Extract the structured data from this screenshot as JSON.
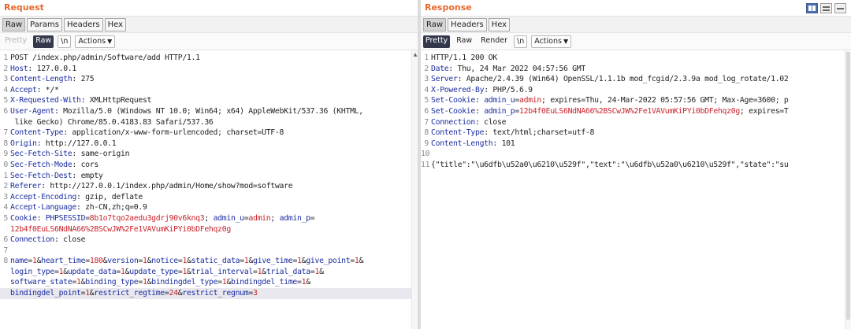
{
  "request": {
    "title": "Request",
    "tabs": [
      "Raw",
      "Params",
      "Headers",
      "Hex"
    ],
    "toolbar": {
      "pretty": "Pretty",
      "raw": "Raw",
      "newline": "\\n",
      "actions": "Actions"
    },
    "lines": [
      {
        "n": "1",
        "parts": [
          [
            "t",
            "POST /index.php/admin/Software/add HTTP/1.1"
          ]
        ]
      },
      {
        "n": "2",
        "parts": [
          [
            "k",
            "Host"
          ],
          [
            "t",
            ": 127.0.0.1"
          ]
        ]
      },
      {
        "n": "3",
        "parts": [
          [
            "k",
            "Content-Length"
          ],
          [
            "t",
            ": 275"
          ]
        ]
      },
      {
        "n": "4",
        "parts": [
          [
            "k",
            "Accept"
          ],
          [
            "t",
            ": */*"
          ]
        ]
      },
      {
        "n": "5",
        "parts": [
          [
            "k",
            "X-Requested-With"
          ],
          [
            "t",
            ": XMLHttpRequest"
          ]
        ]
      },
      {
        "n": "6",
        "parts": [
          [
            "k",
            "User-Agent"
          ],
          [
            "t",
            ": Mozilla/5.0 (Windows NT 10.0; Win64; x64) AppleWebKit/537.36 (KHTML,"
          ]
        ]
      },
      {
        "n": "",
        "parts": [
          [
            "t",
            " like Gecko) Chrome/85.0.4183.83 Safari/537.36"
          ]
        ]
      },
      {
        "n": "7",
        "parts": [
          [
            "k",
            "Content-Type"
          ],
          [
            "t",
            ": application/x-www-form-urlencoded; charset=UTF-8"
          ]
        ]
      },
      {
        "n": "8",
        "parts": [
          [
            "k",
            "Origin"
          ],
          [
            "t",
            ": http://127.0.0.1"
          ]
        ]
      },
      {
        "n": "9",
        "parts": [
          [
            "k",
            "Sec-Fetch-Site"
          ],
          [
            "t",
            ": same-origin"
          ]
        ]
      },
      {
        "n": "0",
        "parts": [
          [
            "k",
            "Sec-Fetch-Mode"
          ],
          [
            "t",
            ": cors"
          ]
        ]
      },
      {
        "n": "1",
        "parts": [
          [
            "k",
            "Sec-Fetch-Dest"
          ],
          [
            "t",
            ": empty"
          ]
        ]
      },
      {
        "n": "2",
        "parts": [
          [
            "k",
            "Referer"
          ],
          [
            "t",
            ": http://127.0.0.1/index.php/admin/Home/show?mod=software"
          ]
        ]
      },
      {
        "n": "3",
        "parts": [
          [
            "k",
            "Accept-Encoding"
          ],
          [
            "t",
            ": gzip, deflate"
          ]
        ]
      },
      {
        "n": "4",
        "parts": [
          [
            "k",
            "Accept-Language"
          ],
          [
            "t",
            ": zh-CN,zh;q=0.9"
          ]
        ]
      },
      {
        "n": "5",
        "parts": [
          [
            "k",
            "Cookie"
          ],
          [
            "t",
            ": "
          ],
          [
            "ck",
            "PHPSESSID"
          ],
          [
            "t",
            "="
          ],
          [
            "cv",
            "8b1o7tqo2aedu3gdrj90v6knq3"
          ],
          [
            "t",
            "; "
          ],
          [
            "ck",
            "admin_u"
          ],
          [
            "t",
            "="
          ],
          [
            "cv",
            "admin"
          ],
          [
            "t",
            "; "
          ],
          [
            "ck",
            "admin_p"
          ],
          [
            "t",
            "="
          ]
        ]
      },
      {
        "n": "",
        "parts": [
          [
            "cv",
            "12b4f0EuLS6NdNA66%2BSCwJW%2Fe1VAVumKiPYi0bDFehqz0g"
          ]
        ]
      },
      {
        "n": "6",
        "parts": [
          [
            "k",
            "Connection"
          ],
          [
            "t",
            ": close"
          ]
        ]
      },
      {
        "n": "7",
        "parts": [
          [
            "t",
            ""
          ]
        ]
      },
      {
        "n": "8",
        "parts": [
          [
            "pk",
            "name"
          ],
          [
            "t",
            "="
          ],
          [
            "pv",
            "1"
          ],
          [
            "t",
            "&"
          ],
          [
            "pk",
            "heart_time"
          ],
          [
            "t",
            "="
          ],
          [
            "pv",
            "180"
          ],
          [
            "t",
            "&"
          ],
          [
            "pk",
            "version"
          ],
          [
            "t",
            "="
          ],
          [
            "pv",
            "1"
          ],
          [
            "t",
            "&"
          ],
          [
            "pk",
            "notice"
          ],
          [
            "t",
            "="
          ],
          [
            "pv",
            "1"
          ],
          [
            "t",
            "&"
          ],
          [
            "pk",
            "static_data"
          ],
          [
            "t",
            "="
          ],
          [
            "pv",
            "1"
          ],
          [
            "t",
            "&"
          ],
          [
            "pk",
            "give_time"
          ],
          [
            "t",
            "="
          ],
          [
            "pv",
            "1"
          ],
          [
            "t",
            "&"
          ],
          [
            "pk",
            "give_point"
          ],
          [
            "t",
            "="
          ],
          [
            "pv",
            "1"
          ],
          [
            "t",
            "&"
          ]
        ]
      },
      {
        "n": "",
        "parts": [
          [
            "pk",
            "login_type"
          ],
          [
            "t",
            "="
          ],
          [
            "pv",
            "1"
          ],
          [
            "t",
            "&"
          ],
          [
            "pk",
            "update_data"
          ],
          [
            "t",
            "="
          ],
          [
            "pv",
            "1"
          ],
          [
            "t",
            "&"
          ],
          [
            "pk",
            "update_type"
          ],
          [
            "t",
            "="
          ],
          [
            "pv",
            "1"
          ],
          [
            "t",
            "&"
          ],
          [
            "pk",
            "trial_interval"
          ],
          [
            "t",
            "="
          ],
          [
            "pv",
            "1"
          ],
          [
            "t",
            "&"
          ],
          [
            "pk",
            "trial_data"
          ],
          [
            "t",
            "="
          ],
          [
            "pv",
            "1"
          ],
          [
            "t",
            "&"
          ]
        ]
      },
      {
        "n": "",
        "parts": [
          [
            "pk",
            "software_state"
          ],
          [
            "t",
            "="
          ],
          [
            "pv",
            "1"
          ],
          [
            "t",
            "&"
          ],
          [
            "pk",
            "binding_type"
          ],
          [
            "t",
            "="
          ],
          [
            "pv",
            "1"
          ],
          [
            "t",
            "&"
          ],
          [
            "pk",
            "bindingdel_type"
          ],
          [
            "t",
            "="
          ],
          [
            "pv",
            "1"
          ],
          [
            "t",
            "&"
          ],
          [
            "pk",
            "bindingdel_time"
          ],
          [
            "t",
            "="
          ],
          [
            "pv",
            "1"
          ],
          [
            "t",
            "&"
          ]
        ]
      },
      {
        "n": "",
        "cursor": true,
        "parts": [
          [
            "pk",
            "bindingdel_point"
          ],
          [
            "t",
            "="
          ],
          [
            "pv",
            "1"
          ],
          [
            "t",
            "&"
          ],
          [
            "pk",
            "restrict_regtime"
          ],
          [
            "t",
            "="
          ],
          [
            "pv",
            "24"
          ],
          [
            "t",
            "&"
          ],
          [
            "pk",
            "restrict_regnum"
          ],
          [
            "t",
            "="
          ],
          [
            "pv",
            "3"
          ]
        ]
      }
    ]
  },
  "response": {
    "title": "Response",
    "tabs": [
      "Raw",
      "Headers",
      "Hex"
    ],
    "toolbar": {
      "pretty": "Pretty",
      "raw": "Raw",
      "render": "Render",
      "newline": "\\n",
      "actions": "Actions"
    },
    "lines": [
      {
        "n": "1",
        "parts": [
          [
            "t",
            "HTTP/1.1 200 OK"
          ]
        ]
      },
      {
        "n": "2",
        "parts": [
          [
            "k",
            "Date"
          ],
          [
            "t",
            ": Thu, 24 Mar 2022 04:57:56 GMT"
          ]
        ]
      },
      {
        "n": "3",
        "parts": [
          [
            "k",
            "Server"
          ],
          [
            "t",
            ": Apache/2.4.39 (Win64) OpenSSL/1.1.1b mod_fcgid/2.3.9a mod_log_rotate/1.02"
          ]
        ]
      },
      {
        "n": "4",
        "parts": [
          [
            "k",
            "X-Powered-By"
          ],
          [
            "t",
            ": PHP/5.6.9"
          ]
        ]
      },
      {
        "n": "5",
        "parts": [
          [
            "k",
            "Set-Cookie"
          ],
          [
            "t",
            ": "
          ],
          [
            "ck",
            "admin_u"
          ],
          [
            "t",
            "="
          ],
          [
            "cv",
            "admin"
          ],
          [
            "t",
            "; expires=Thu, 24-Mar-2022 05:57:56 GMT; Max-Age=3600; p"
          ]
        ]
      },
      {
        "n": "6",
        "parts": [
          [
            "k",
            "Set-Cookie"
          ],
          [
            "t",
            ": "
          ],
          [
            "ck",
            "admin_p"
          ],
          [
            "t",
            "="
          ],
          [
            "cv",
            "12b4f0EuLS6NdNA66%2BSCwJW%2Fe1VAVumKiPYi0bDFehqz0g"
          ],
          [
            "t",
            "; expires=T"
          ]
        ]
      },
      {
        "n": "7",
        "parts": [
          [
            "k",
            "Connection"
          ],
          [
            "t",
            ": close"
          ]
        ]
      },
      {
        "n": "8",
        "parts": [
          [
            "k",
            "Content-Type"
          ],
          [
            "t",
            ": text/html;charset=utf-8"
          ]
        ]
      },
      {
        "n": "9",
        "parts": [
          [
            "k",
            "Content-Length"
          ],
          [
            "t",
            ": 101"
          ]
        ]
      },
      {
        "n": "10",
        "parts": [
          [
            "t",
            ""
          ]
        ]
      },
      {
        "n": "11",
        "parts": [
          [
            "t",
            "{\"title\":\"\\u6dfb\\u52a0\\u6210\\u529f\",\"text\":\"\\u6dfb\\u52a0\\u6210\\u529f\",\"state\":\"su"
          ]
        ]
      }
    ]
  },
  "layout_buttons": [
    "split-horizontal-icon",
    "split-vertical-icon",
    "single-pane-icon"
  ],
  "colors": {
    "title": "#e8682a",
    "header_key": "#1c2ea0",
    "value_red": "#c8222a",
    "selected_toolbar": "#34384d"
  }
}
